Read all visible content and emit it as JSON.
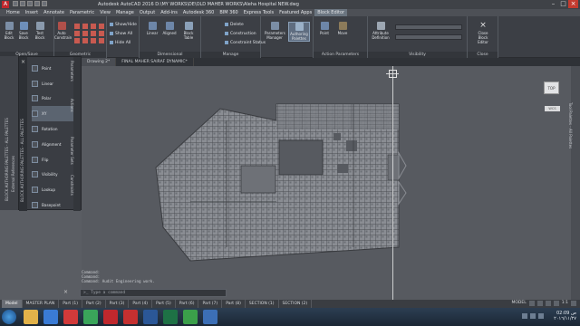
{
  "titlebar": {
    "title": "Autodesk AutoCAD 2016  D:\\MY WORKS\\DE\\OLD MAHER WORKS\\Aleha Hospital NEW.dwg"
  },
  "menubar": [
    "Home",
    "Insert",
    "Annotate",
    "Parametric",
    "View",
    "Manage",
    "Output",
    "Add-ins",
    "Autodesk 360",
    "BIM 360",
    "Express Tools",
    "Featured Apps",
    "Block Editor"
  ],
  "menubar_active": "Block Editor",
  "ribbon": {
    "groups": {
      "open_save": "Open/Save",
      "geometric": "Geometric",
      "dimensional": "Dimensional",
      "manage": "Manage",
      "action_parameters": "Action Parameters",
      "visibility": "Visibility",
      "close": "Close"
    },
    "buttons": {
      "edit_block": "Edit Block",
      "save_block": "Save Block",
      "test_block": "Test Block",
      "auto_constrain": "Auto Constrain",
      "show_hide": "Show/Hide",
      "show_all": "Show All",
      "hide_all": "Hide All",
      "linear": "Linear",
      "aligned": "Aligned",
      "block_table": "Block Table",
      "delete": "Delete",
      "construction": "Construction",
      "constraint_status": "Constraint Status",
      "parameters_manager": "Parameters Manager",
      "authoring_palettes": "Authoring Palettes",
      "point": "Point",
      "move": "Move",
      "attribute_definition": "Attribute Definition",
      "close_block_editor": "Close Block Editor"
    }
  },
  "doctabs": [
    "Drawing 2*",
    "FINAL MAHER SAIRAF DYNAMIC*"
  ],
  "palette": {
    "title": "BLOCK AUTHORING PALETTES - ALL PALETTES",
    "tabs": [
      "Parameters",
      "Actions",
      "Parameter Sets",
      "Constraints"
    ],
    "items": [
      "Point",
      "Linear",
      "Polar",
      "XY",
      "Rotation",
      "Alignment",
      "Flip",
      "Visibility",
      "Lookup",
      "Basepoint"
    ]
  },
  "leftstrip": {
    "label1": "External References",
    "label2": "BLOCK AUTHORING PALETTES - ALL PALETTES"
  },
  "rightstrip": {
    "label": "Tool Palettes - All Palettes"
  },
  "viewcube": {
    "face": "TOP",
    "wcs": "WCS"
  },
  "command": {
    "history": [
      "Command:",
      "Command:",
      "Command:  Audit Engineering work."
    ],
    "placeholder": "Type a command"
  },
  "layout_tabs": [
    "Model",
    "MASTER PLAN",
    "Part (1)",
    "Part (2)",
    "Part (3)",
    "Part (4)",
    "Part (5)",
    "Part (6)",
    "Part (7)",
    "Part (8)",
    "SECTION (1)",
    "SECTION (2)"
  ],
  "layout_active": "Model",
  "status": {
    "model": "MODEL",
    "scale": "1:1"
  },
  "taskbar": {
    "time": "02:09 ص",
    "date": "٢٠١٦/١١/٢٧",
    "apps": [
      {
        "name": "explorer",
        "color": "#e2b24a"
      },
      {
        "name": "media-player",
        "color": "#3a7bd5"
      },
      {
        "name": "opera",
        "color": "#d23a3a"
      },
      {
        "name": "chrome",
        "color": "#3aa55a"
      },
      {
        "name": "autocad",
        "color": "#c0282d"
      },
      {
        "name": "pdf",
        "color": "#c53030"
      },
      {
        "name": "word",
        "color": "#2b5797"
      },
      {
        "name": "excel",
        "color": "#1e7145"
      },
      {
        "name": "camtasia",
        "color": "#3b9f4a"
      },
      {
        "name": "app-c",
        "color": "#3c6fb6"
      }
    ]
  },
  "colors": {
    "accent": "#5f6d80",
    "ribbon": "#3c3f45",
    "canvas": "#575a60"
  }
}
